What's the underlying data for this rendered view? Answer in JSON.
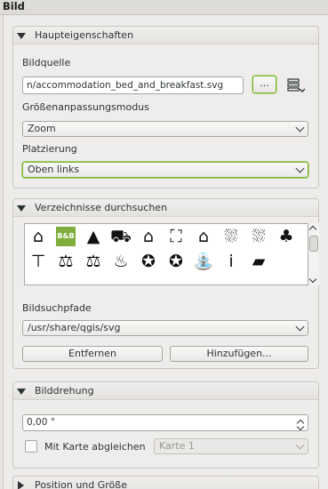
{
  "header": {
    "title": "Bild"
  },
  "main_group": {
    "title": "Haupteigenschaften",
    "source_label": "Bildquelle",
    "source_value": "n/accommodation_bed_and_breakfast.svg",
    "browse_label": "...",
    "resize_label": "Größenanpassungsmodus",
    "resize_value": "Zoom",
    "placement_label": "Platzierung",
    "placement_value": "Oben links"
  },
  "browse_group": {
    "title": "Verzeichnisse durchsuchen",
    "svg_icons": [
      {
        "name": "hut-icon",
        "glyph": "⌂"
      },
      {
        "name": "bed-and-breakfast-icon",
        "glyph": "B&B"
      },
      {
        "name": "tent-icon",
        "glyph": "▲"
      },
      {
        "name": "caravan-icon",
        "glyph": "⛟"
      },
      {
        "name": "chalet-icon",
        "glyph": "⌂"
      },
      {
        "name": "bed-icon",
        "glyph": "⛶"
      },
      {
        "name": "house-icon",
        "glyph": "⌂"
      },
      {
        "name": "shelter-rain-icon",
        "glyph": "⛆"
      },
      {
        "name": "shelter-rain-icon-2",
        "glyph": "⛆"
      },
      {
        "name": "trees-icon",
        "glyph": "♣"
      },
      {
        "name": "picnic-table-icon",
        "glyph": "⊤"
      },
      {
        "name": "scales-icon",
        "glyph": "⚖"
      },
      {
        "name": "scales-icon-2",
        "glyph": "⚖"
      },
      {
        "name": "fire-icon",
        "glyph": "♨"
      },
      {
        "name": "fire-emblem-icon",
        "glyph": "✪"
      },
      {
        "name": "fire-emblem-icon-2",
        "glyph": "✪"
      },
      {
        "name": "fountain-icon",
        "glyph": "⛲"
      },
      {
        "name": "info-icon",
        "glyph": "i"
      },
      {
        "name": "book-icon",
        "glyph": "▰"
      }
    ],
    "paths_label": "Bildsuchpfade",
    "path_value": "/usr/share/qgis/svg",
    "remove_label": "Entfernen",
    "add_label": "Hinzufügen..."
  },
  "rotation_group": {
    "title": "Bilddrehung",
    "rotation_value": "0,00 °",
    "sync_label": "Mit Karte abgleichen",
    "map_value": "Karte 1"
  },
  "position_group": {
    "title": "Position und Größe"
  }
}
